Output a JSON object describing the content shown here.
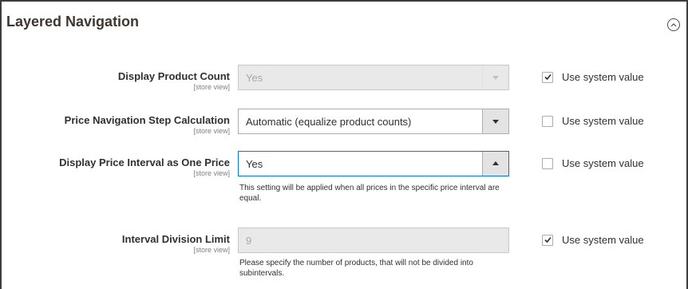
{
  "section": {
    "title": "Layered Navigation"
  },
  "fields": [
    {
      "label": "Display Product Count",
      "scope": "[store view]",
      "value": "Yes",
      "control": "select",
      "state": "disabled",
      "use_system_value_label": "Use system value",
      "use_system_value_checked": true
    },
    {
      "label": "Price Navigation Step Calculation",
      "scope": "[store view]",
      "value": "Automatic (equalize product counts)",
      "control": "select",
      "state": "enabled",
      "use_system_value_label": "Use system value",
      "use_system_value_checked": false
    },
    {
      "label": "Display Price Interval as One Price",
      "scope": "[store view]",
      "value": "Yes",
      "control": "select",
      "state": "focused",
      "note": "This setting will be applied when all prices in the specific price interval are equal.",
      "use_system_value_label": "Use system value",
      "use_system_value_checked": false
    },
    {
      "label": "Interval Division Limit",
      "scope": "[store view]",
      "value": "9",
      "control": "input",
      "state": "disabled",
      "note": "Please specify the number of products, that will not be divided into subintervals.",
      "use_system_value_label": "Use system value",
      "use_system_value_checked": true
    }
  ],
  "icons": {
    "collapse": "chevron-up-circle-icon",
    "dropdown": "triangle-down-icon",
    "dropdown_open": "triangle-up-icon",
    "check": "check-icon"
  },
  "colors": {
    "focus_border": "#007bdb",
    "disabled_bg": "#e9e9e9",
    "frame": "#3d3d3d"
  }
}
